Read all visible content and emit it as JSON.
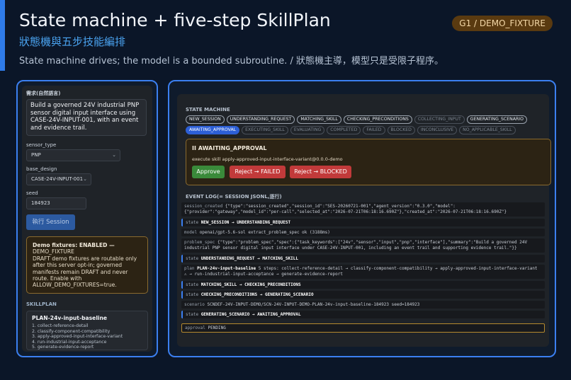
{
  "header": {
    "title": "State machine + five-step SkillPlan",
    "subtitle": "狀態機與五步技能編排",
    "description": "State machine drives; the model is a bounded subroutine. / 狀態機主導，模型只是受限子程序。",
    "badge": "G1 / DEMO_FIXTURE"
  },
  "left": {
    "request_label": "需求(自然語言)",
    "request_text": "Build a governed 24V industrial PNP sensor digital input interface using CASE-24V-INPUT-001, with an event and evidence trail.",
    "sensor_type_label": "sensor_type",
    "sensor_type_value": "PNP",
    "base_design_label": "base_design",
    "base_design_value": "CASE-24V-INPUT-001",
    "seed_label": "seed",
    "seed_value": "184923",
    "run_button": "執行 Session",
    "demo": {
      "heading": "Demo fixtures: ENABLED —",
      "name": "DEMO_FIXTURE",
      "body": "DRAFT demo fixtures are routable only after this server opt-in; governed manifests remain DRAFT and never route. Enable with ALLOW_DEMO_FIXTURES=true."
    },
    "skillplan_label": "SKILLPLAN",
    "skillplan_title": "PLAN-24v-input-baseline",
    "steps": [
      "1. collect-reference-detail",
      "2. classify-component-compatibility",
      "3. apply-approved-input-interface-variant",
      "4. run-industrial-input-acceptance",
      "5. generate-evidence-report"
    ]
  },
  "right": {
    "state_machine_label": "STATE MACHINE",
    "states": [
      {
        "label": "NEW_SESSION",
        "status": "done"
      },
      {
        "label": "UNDERSTANDING_REQUEST",
        "status": "done"
      },
      {
        "label": "MATCHING_SKILL",
        "status": "done"
      },
      {
        "label": "CHECKING_PRECONDITIONS",
        "status": "done"
      },
      {
        "label": "COLLECTING_INPUT",
        "status": "dim"
      },
      {
        "label": "GENERATING_SCENARIO",
        "status": "done"
      },
      {
        "label": "AWAITING_APPROVAL",
        "status": "active"
      },
      {
        "label": "EXECUTING_SKILL",
        "status": "dim"
      },
      {
        "label": "EVALUATING",
        "status": "dim"
      },
      {
        "label": "COMPLETED",
        "status": "dim"
      },
      {
        "label": "FAILED",
        "status": "dim"
      },
      {
        "label": "BLOCKED",
        "status": "dim"
      },
      {
        "label": "INCONCLUSIVE",
        "status": "dim"
      },
      {
        "label": "NO_APPLICABLE_SKILL",
        "status": "dim"
      }
    ],
    "approval": {
      "title": "II AWAITING_APPROVAL",
      "text": "execute skill apply-approved-input-interface-variant@0.0.0-demo",
      "approve": "Approve",
      "reject_failed": "Reject → FAILED",
      "reject_blocked": "Reject → BLOCKED"
    },
    "event_log_label": "EVENT LOG(= SESSION JSONL,逐行)",
    "events": [
      {
        "kind": "session_created",
        "text": "{\"type\":\"session_created\",\"session_id\":\"SES-20260721-001\",\"agent_version\":\"0.3.0\",\"model\":{\"provider\":\"gateway\",\"model_id\":\"per-call\",\"selected_at\":\"2026-07-21T06:18:16.690Z\"},\"created_at\":\"2026-07-21T06:18:16.690Z\"}"
      },
      {
        "kind": "state",
        "text": "NEW_SESSION → UNDERSTANDING_REQUEST"
      },
      {
        "kind": "model",
        "text": "openai/gpt-5.6-sol extract_problem_spec ok (3188ms)"
      },
      {
        "kind": "problem_spec",
        "text": "{\"type\":\"problem_spec\",\"spec\":{\"task_keywords\":[\"24v\",\"sensor\",\"input\",\"pnp\",\"interface\"],\"summary\":\"Build a governed 24V industrial PNP sensor digital input interface under CASE-24V-INPUT-001, including an event trail and supporting evidence trail.\"}}"
      },
      {
        "kind": "state",
        "text": "UNDERSTANDING_REQUEST → MATCHING_SKILL"
      },
      {
        "kind": "plan",
        "text_bold": "PLAN-24v-input-baseline",
        "text": "5 steps: collect-reference-detail → classify-component-compatibility → apply-approved-input-interface-variant ⚠ → run-industrial-input-acceptance → generate-evidence-report"
      },
      {
        "kind": "state",
        "text": "MATCHING_SKILL → CHECKING_PRECONDITIONS"
      },
      {
        "kind": "state",
        "text": "CHECKING_PRECONDITIONS → GENERATING_SCENARIO"
      },
      {
        "kind": "scenario",
        "text": "SCNDEF-24V-INPUT-DEMO/SCN-24V-INPUT-DEMO-PLAN-24v-input-baseline-184923 seed=184923"
      },
      {
        "kind": "state",
        "text": "GENERATING_SCENARIO → AWAITING_APPROVAL"
      },
      {
        "kind": "approval",
        "text": "PENDING"
      }
    ]
  }
}
